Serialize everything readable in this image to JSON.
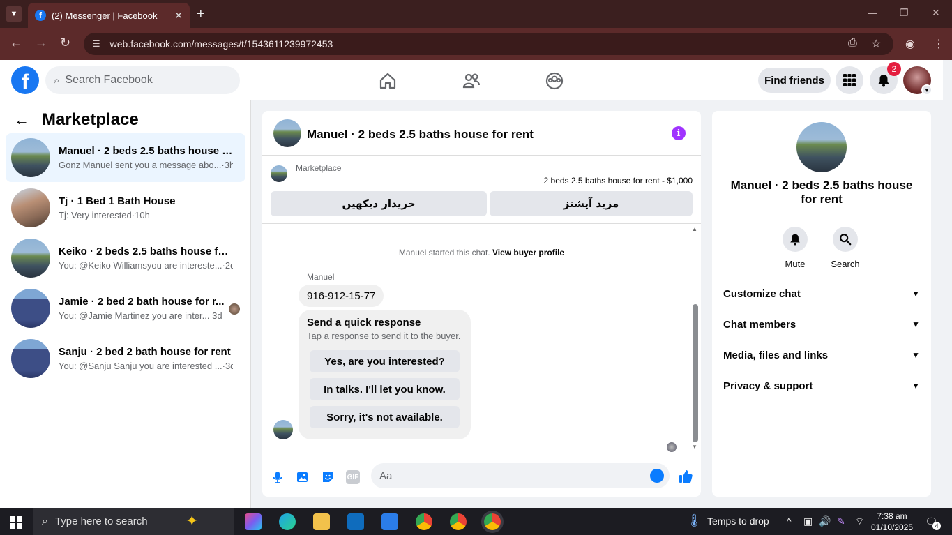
{
  "browser": {
    "tab_title": "(2) Messenger | Facebook",
    "url": "web.facebook.com/messages/t/1543611239972453"
  },
  "header": {
    "search_placeholder": "Search Facebook",
    "find_friends": "Find friends",
    "notif_count": "2"
  },
  "sidebar": {
    "title": "Marketplace",
    "conversations": [
      {
        "name": "Manuel · 2 beds 2.5 baths house f...",
        "preview": "Gonz Manuel sent you a message abo...",
        "time": "3h"
      },
      {
        "name": "Tj · 1 Bed 1 Bath House",
        "preview": "Tj: Very interested",
        "time": "10h"
      },
      {
        "name": "Keiko · 2 beds 2.5 baths house for ...",
        "preview": "You: @Keiko Williamsyou are intereste...",
        "time": "2d"
      },
      {
        "name": "Jamie · 2 bed 2 bath house for r...",
        "preview": "You: @Jamie Martinez you are inter...",
        "time": "3d"
      },
      {
        "name": "Sanju · 2 bed 2 bath house for rent",
        "preview": "You: @Sanju Sanju you are interested ...",
        "time": "3d"
      }
    ]
  },
  "chat": {
    "title": "Manuel · 2 beds 2.5 baths house for rent",
    "marketplace_label": "Marketplace",
    "listing_price": "2 beds 2.5 baths house for rent - $1,000",
    "btn_buyer": "خریدار دیکھیں",
    "btn_options": "مزید آپشنز",
    "start_text": "Manuel started this chat.",
    "view_buyer": "View buyer profile",
    "sender_name": "Manuel",
    "message": "916-912-15-77",
    "quick_title": "Send a quick response",
    "quick_sub": "Tap a response to send it to the buyer.",
    "quick_responses": [
      "Yes, are you interested?",
      "In talks. I'll let you know.",
      "Sorry, it's not available."
    ],
    "composer_placeholder": "Aa"
  },
  "info_panel": {
    "name": "Manuel · 2 beds 2.5 baths house for rent",
    "mute": "Mute",
    "search": "Search",
    "sections": [
      "Customize chat",
      "Chat members",
      "Media, files and links",
      "Privacy & support"
    ]
  },
  "taskbar": {
    "search_placeholder": "Type here to search",
    "weather": "Temps to drop",
    "time": "7:38 am",
    "date": "01/10/2025",
    "notif_count": "4"
  }
}
